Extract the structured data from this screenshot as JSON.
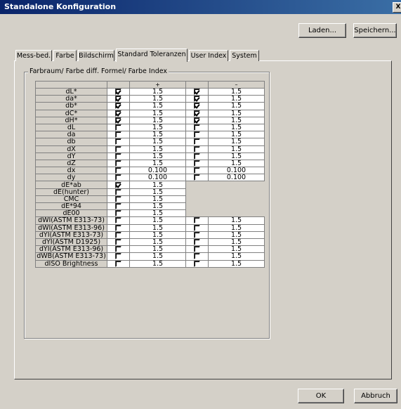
{
  "window": {
    "title": "Standalone Konfiguration",
    "close_label": "X"
  },
  "toolbar": {
    "load_label": "Laden...",
    "save_label": "Speichern..."
  },
  "tabs": [
    "Mess-bed.",
    "Farbe",
    "Bildschirm",
    "Standard Toleranzen",
    "User Index",
    "System"
  ],
  "active_tab": "Standard Toleranzen",
  "group": {
    "title": "Farbraum/ Farbe diff. Formel/ Farbe Index",
    "header_plus": "+",
    "header_minus": "–"
  },
  "rows": [
    {
      "label": "dL*",
      "plus_checked": true,
      "plus": "1.5",
      "minus_checked": true,
      "minus": "1.5"
    },
    {
      "label": "da*",
      "plus_checked": true,
      "plus": "1.5",
      "minus_checked": true,
      "minus": "1.5"
    },
    {
      "label": "db*",
      "plus_checked": true,
      "plus": "1.5",
      "minus_checked": true,
      "minus": "1.5"
    },
    {
      "label": "dC*",
      "plus_checked": true,
      "plus": "1.5",
      "minus_checked": true,
      "minus": "1.5"
    },
    {
      "label": "dH*",
      "plus_checked": true,
      "plus": "1.5",
      "minus_checked": true,
      "minus": "1.5"
    },
    {
      "label": "dL",
      "plus_checked": false,
      "plus": "1.5",
      "minus_checked": false,
      "minus": "1.5"
    },
    {
      "label": "da",
      "plus_checked": false,
      "plus": "1.5",
      "minus_checked": false,
      "minus": "1.5"
    },
    {
      "label": "db",
      "plus_checked": false,
      "plus": "1.5",
      "minus_checked": false,
      "minus": "1.5"
    },
    {
      "label": "dX",
      "plus_checked": false,
      "plus": "1.5",
      "minus_checked": false,
      "minus": "1.5"
    },
    {
      "label": "dY",
      "plus_checked": false,
      "plus": "1.5",
      "minus_checked": false,
      "minus": "1.5"
    },
    {
      "label": "dZ",
      "plus_checked": false,
      "plus": "1.5",
      "minus_checked": false,
      "minus": "1.5"
    },
    {
      "label": "dx",
      "plus_checked": false,
      "plus": "0.100",
      "minus_checked": false,
      "minus": "0.100"
    },
    {
      "label": "dy",
      "plus_checked": false,
      "plus": "0.100",
      "minus_checked": false,
      "minus": "0.100"
    },
    {
      "label": "dE*ab",
      "plus_checked": true,
      "plus": "1.5",
      "minus_checked": null,
      "minus": null
    },
    {
      "label": "dE(hunter)",
      "plus_checked": false,
      "plus": "1.5",
      "minus_checked": null,
      "minus": null
    },
    {
      "label": "CMC",
      "plus_checked": false,
      "plus": "1.5",
      "minus_checked": null,
      "minus": null
    },
    {
      "label": "dE*94",
      "plus_checked": false,
      "plus": "1.5",
      "minus_checked": null,
      "minus": null
    },
    {
      "label": "dE00",
      "plus_checked": false,
      "plus": "1.5",
      "minus_checked": null,
      "minus": null
    },
    {
      "label": "dWI(ASTM E313-73)",
      "plus_checked": false,
      "plus": "1.5",
      "minus_checked": false,
      "minus": "1.5"
    },
    {
      "label": "dWI(ASTM E313-96)",
      "plus_checked": false,
      "plus": "1.5",
      "minus_checked": false,
      "minus": "1.5"
    },
    {
      "label": "dYI(ASTM E313-73)",
      "plus_checked": false,
      "plus": "1.5",
      "minus_checked": false,
      "minus": "1.5"
    },
    {
      "label": "dYI(ASTM D1925)",
      "plus_checked": false,
      "plus": "1.5",
      "minus_checked": false,
      "minus": "1.5"
    },
    {
      "label": "dYI(ASTM E313-96)",
      "plus_checked": false,
      "plus": "1.5",
      "minus_checked": false,
      "minus": "1.5"
    },
    {
      "label": "dWB(ASTM E313-73)",
      "plus_checked": false,
      "plus": "1.5",
      "minus_checked": false,
      "minus": "1.5"
    },
    {
      "label": "dISO Brightness",
      "plus_checked": false,
      "plus": "1.5",
      "minus_checked": false,
      "minus": "1.5"
    }
  ],
  "footer": {
    "ok_label": "OK",
    "cancel_label": "Abbruch"
  },
  "colors": {
    "title_start": "#0a246a",
    "title_end": "#3a6ea5",
    "face": "#d4d0c8"
  }
}
